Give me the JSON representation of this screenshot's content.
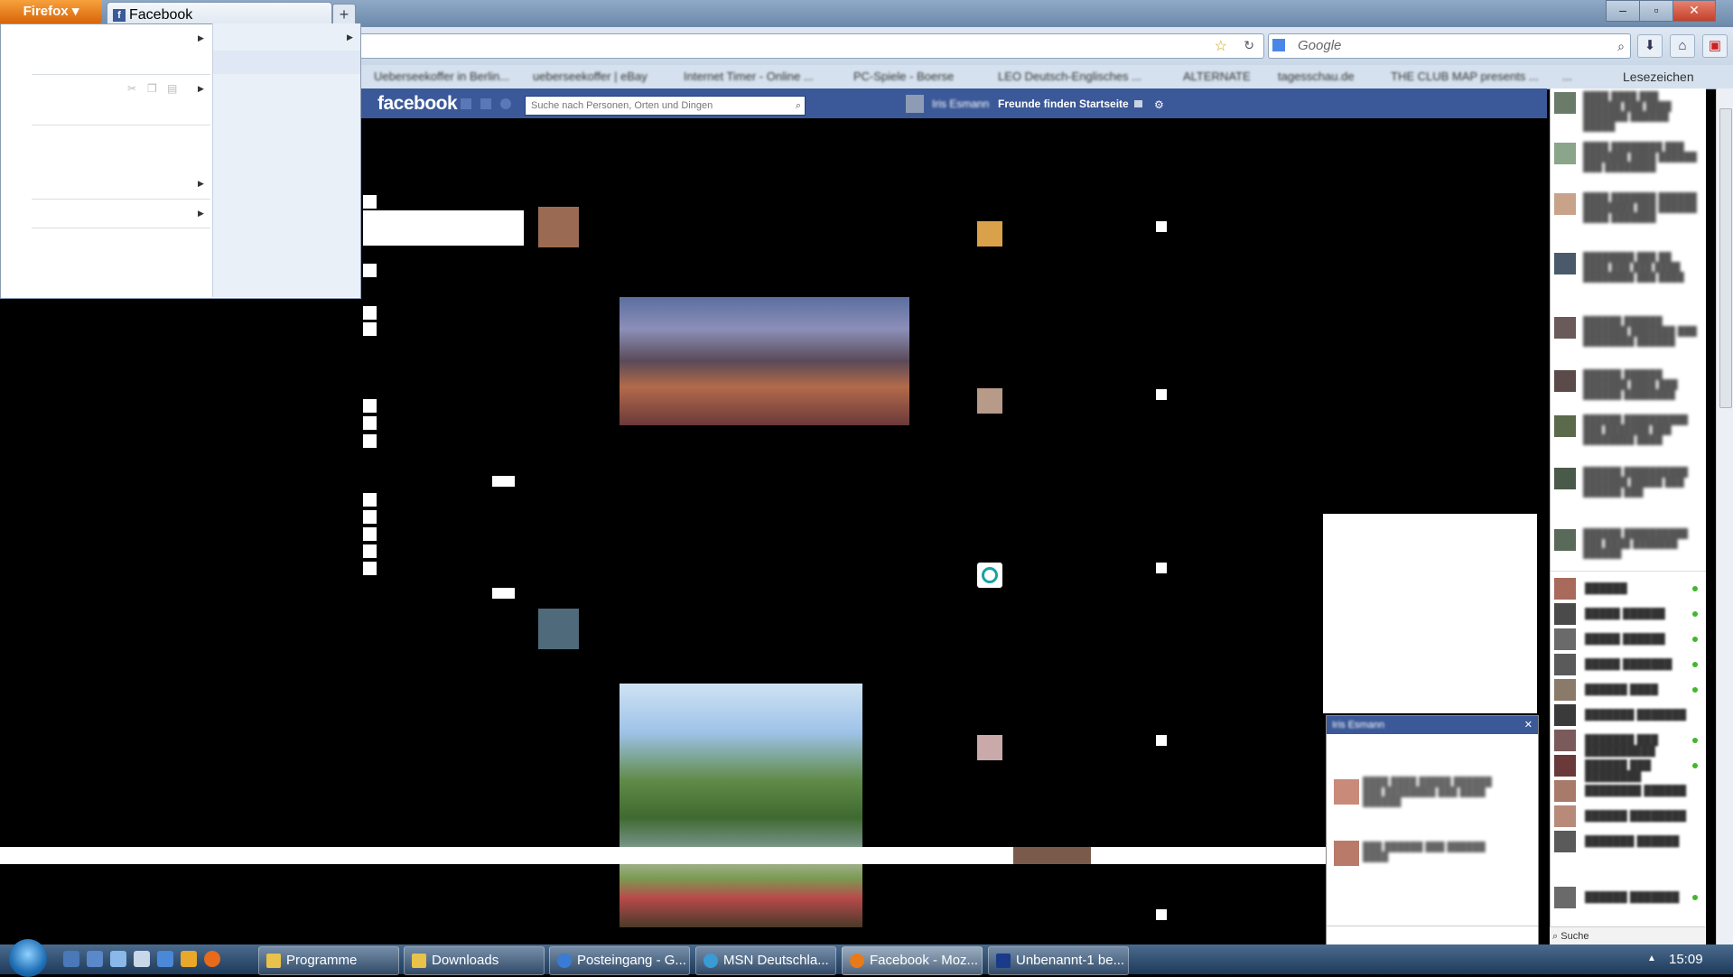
{
  "browser": {
    "menu_button": "Firefox",
    "tab_title": "Facebook",
    "search_placeholder": "Google",
    "bookmarks": [
      "Ueberseekoffer in Berlin...",
      "ueberseekoffer | eBay",
      "Internet Timer - Online ...",
      "PC-Spiele - Boerse",
      "LEO Deutsch-Englisches ...",
      "ALTERNATE",
      "tagesschau.de",
      "THE CLUB MAP presents ...",
      "...",
      "Lesezeichen"
    ]
  },
  "facebook": {
    "logo": "facebook",
    "search_placeholder": "Suche nach Personen, Orten und Dingen",
    "user_name": "Iris Esmann",
    "nav_find_friends": "Freunde finden",
    "nav_home": "Startseite"
  },
  "sidebar": {
    "search_label": "Suche"
  },
  "chat": {
    "title": "Iris Esmann"
  },
  "taskbar": {
    "items": [
      {
        "label": "Programme",
        "color": "#e8c24a"
      },
      {
        "label": "Downloads",
        "color": "#e8c24a"
      },
      {
        "label": "Posteingang - G...",
        "color": "#3a7bd5"
      },
      {
        "label": "MSN Deutschla...",
        "color": "#3a9bd5"
      },
      {
        "label": "Facebook - Moz...",
        "color": "#e87a1a"
      },
      {
        "label": "Unbenannt-1 be...",
        "color": "#1a3a8a"
      }
    ],
    "time": "15:09"
  },
  "colors": {
    "facebook_blue": "#3b5998",
    "firefox_orange": "#e87a1a"
  }
}
